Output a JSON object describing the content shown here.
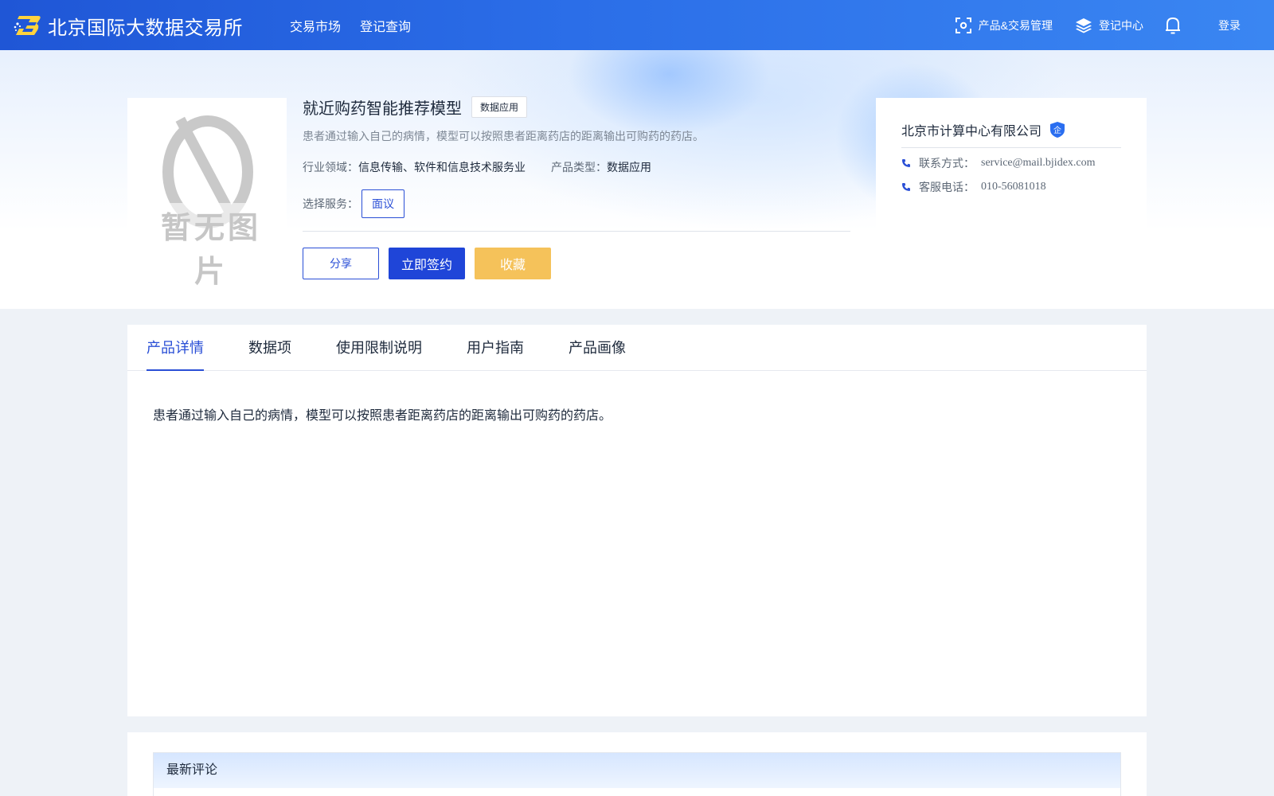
{
  "header": {
    "brand_name": "北京国际大数据交易所",
    "nav": [
      "交易市场",
      "登记查询"
    ],
    "product_mgmt": "产品&交易管理",
    "register_center": "登记中心",
    "login": "登录"
  },
  "product": {
    "image_placeholder": "暂无图片",
    "title": "就近购药智能推荐模型",
    "tag": "数据应用",
    "description": "患者通过输入自己的病情，模型可以按照患者距离药店的距离输出可购药的药店。",
    "industry_label": "行业领域：",
    "industry_value": "信息传输、软件和信息技术服务业",
    "type_label": "产品类型：",
    "type_value": "数据应用",
    "service_label": "选择服务：",
    "service_option": "面议",
    "share_label": "分享",
    "sign_label": "立即签约",
    "favorite_label": "收藏"
  },
  "company": {
    "name": "北京市计算中心有限公司",
    "badge": "企",
    "contact_label": "联系方式：",
    "contact_value": "service@mail.bjidex.com",
    "phone_label": "客服电话：",
    "phone_value": "010-56081018"
  },
  "tabs": [
    "产品详情",
    "数据项",
    "使用限制说明",
    "用户指南",
    "产品画像"
  ],
  "active_tab": 0,
  "detail_text": "患者通过输入自己的病情，模型可以按照患者距离药店的距离输出可购药的药店。",
  "comments": {
    "title": "最新评论"
  },
  "colors": {
    "primary": "#1f45d8",
    "accent_blue": "#2a4fd6",
    "favorite": "#f5c25a",
    "topbar_start": "#1f56d6",
    "topbar_end": "#3a86f2"
  }
}
